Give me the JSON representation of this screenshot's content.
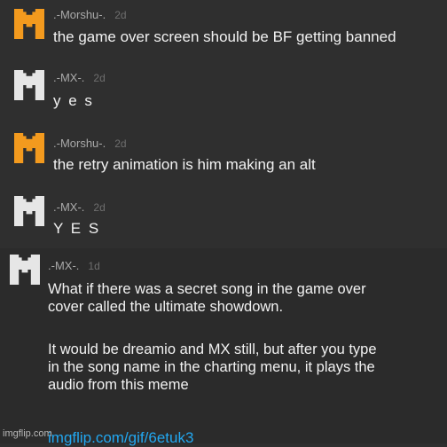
{
  "colors": {
    "orange_avatar": "#f39a1e",
    "white_avatar": "#e6e6e6",
    "link": "#22a7f0"
  },
  "comments": [
    {
      "avatar_icon": "m-logo-icon",
      "username": ".-Morshu-.",
      "time": "2d",
      "text": "the game over screen should be BF getting banned"
    },
    {
      "avatar_icon": "m-logo-icon",
      "username": ".-MX-.",
      "time": "2d",
      "text": "y e s"
    },
    {
      "avatar_icon": "m-logo-icon",
      "username": ".-Morshu-.",
      "time": "2d",
      "text": "the retry animation is him making an alt"
    },
    {
      "avatar_icon": "m-logo-icon",
      "username": ".-MX-.",
      "time": "2d",
      "text": "Y E S"
    },
    {
      "avatar_icon": "m-logo-icon",
      "username": ".-MX-.",
      "time": "1d",
      "lines": [
        "What if there was a secret song in the game over",
        "cover called the ultimate showdown.",
        "It would be dreamio and MX still, but after you type",
        "in the song name in the charting menu, it plays the",
        "audio from this meme"
      ],
      "link": "imgflip.com/gif/6etuk3"
    }
  ],
  "watermark": "imgflip.com"
}
